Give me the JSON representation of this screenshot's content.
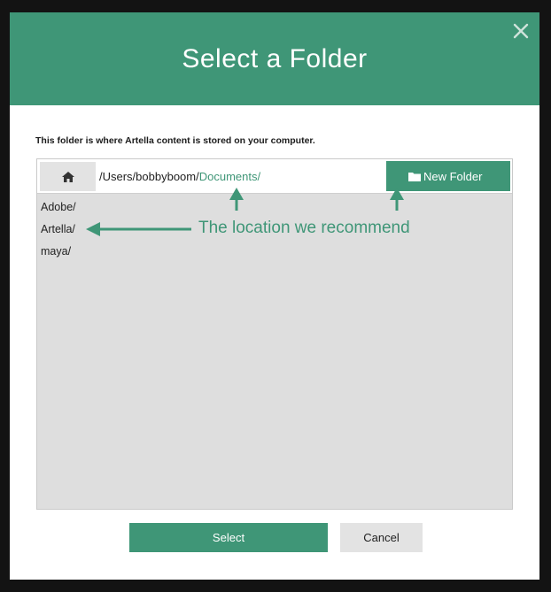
{
  "dialog": {
    "title": "Select a Folder",
    "description": "This folder is where Artella content is stored on your computer.",
    "close_icon": "close-icon"
  },
  "pathbar": {
    "home_icon": "home-icon",
    "path_prefix": "/Users/bobbyboom/",
    "path_highlight": "Documents/",
    "new_folder_label": "New Folder",
    "new_folder_icon": "folder-icon"
  },
  "folders": [
    {
      "label": "Adobe/"
    },
    {
      "label": "Artella/"
    },
    {
      "label": "maya/"
    }
  ],
  "annotation": {
    "text": "The location we recommend"
  },
  "actions": {
    "select_label": "Select",
    "cancel_label": "Cancel"
  },
  "colors": {
    "accent": "#3f9677",
    "button_gray": "#e3e3e3",
    "list_background": "#dedede",
    "frame_background": "#131313"
  }
}
